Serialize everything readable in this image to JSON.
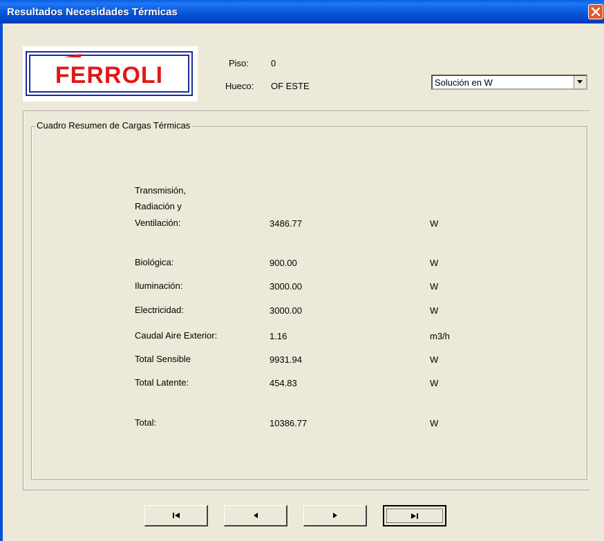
{
  "window": {
    "title": "Resultados Necesidades Térmicas"
  },
  "logo": {
    "text": "FERROLI",
    "colors": {
      "brand_red": "#e01818",
      "brand_blue": "#1a2a9c"
    }
  },
  "info": {
    "piso_label": "Piso:",
    "piso_value": "0",
    "hueco_label": "Hueco:",
    "hueco_value": "OF ESTE"
  },
  "unit_select": {
    "selected": "Solución en W"
  },
  "summary": {
    "title": "Cuadro Resumen de Cargas Térmicas",
    "transmission": {
      "label_line1": "Transmisión,",
      "label_line2": "Radiación y",
      "label_line3": "Ventilación:",
      "value": "3486.77",
      "unit": "W"
    },
    "rows": [
      {
        "label": "Biológica:",
        "value": "900.00",
        "unit": "W"
      },
      {
        "label": "Iluminación:",
        "value": "3000.00",
        "unit": "W"
      },
      {
        "label": "Electricidad:",
        "value": "3000.00",
        "unit": "W"
      },
      {
        "label": "Caudal Aire Exterior:",
        "value": "1.16",
        "unit": "m3/h"
      },
      {
        "label": "Total Sensible",
        "value": "9931.94",
        "unit": "W"
      },
      {
        "label": "Total Latente:",
        "value": "454.83",
        "unit": "W"
      }
    ],
    "total": {
      "label": "Total:",
      "value": "10386.77",
      "unit": "W"
    }
  },
  "navigation": {
    "buttons": [
      "first-icon",
      "previous-icon",
      "next-icon",
      "last-icon"
    ]
  }
}
